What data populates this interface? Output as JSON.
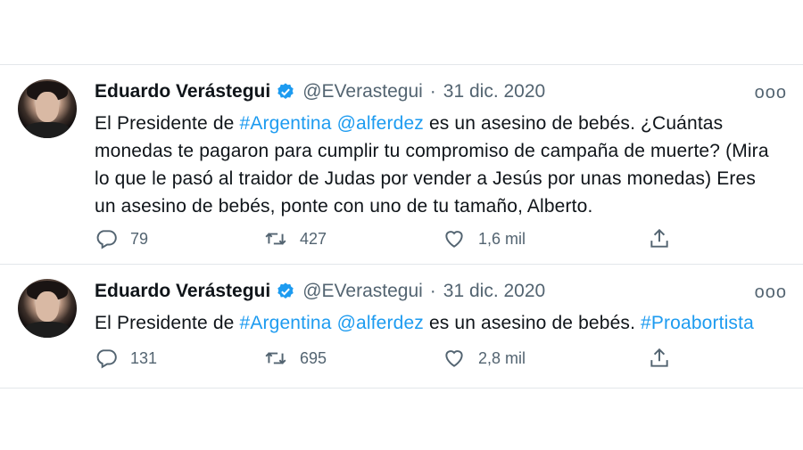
{
  "tweets": [
    {
      "author": "Eduardo Verástegui",
      "handle": "@EVerastegui",
      "separator": "·",
      "date": "31 dic. 2020",
      "more": "ooo",
      "text": [
        {
          "t": "El Presidente de ",
          "link": false
        },
        {
          "t": "#Argentina",
          "link": true
        },
        {
          "t": " ",
          "link": false
        },
        {
          "t": "@alferdez",
          "link": true
        },
        {
          "t": " es un asesino de bebés. ¿Cuántas monedas te pagaron para cumplir tu compromiso de campaña de muerte? (Mira lo que le pasó al traidor de Judas por vender a Jesús por unas monedas) Eres un asesino de bebés, ponte con uno de tu tamaño, Alberto.",
          "link": false
        }
      ],
      "replies": "79",
      "retweets": "427",
      "likes": "1,6 mil"
    },
    {
      "author": "Eduardo Verástegui",
      "handle": "@EVerastegui",
      "separator": "·",
      "date": "31 dic. 2020",
      "more": "ooo",
      "text": [
        {
          "t": "El Presidente de ",
          "link": false
        },
        {
          "t": "#Argentina",
          "link": true
        },
        {
          "t": " ",
          "link": false
        },
        {
          "t": "@alferdez",
          "link": true
        },
        {
          "t": " es un asesino de bebés. ",
          "link": false
        },
        {
          "t": "#Proabortista",
          "link": true
        }
      ],
      "replies": "131",
      "retweets": "695",
      "likes": "2,8 mil"
    }
  ],
  "colors": {
    "link": "#1d9bf0",
    "verified": "#1d9bf0",
    "muted": "#536471"
  }
}
